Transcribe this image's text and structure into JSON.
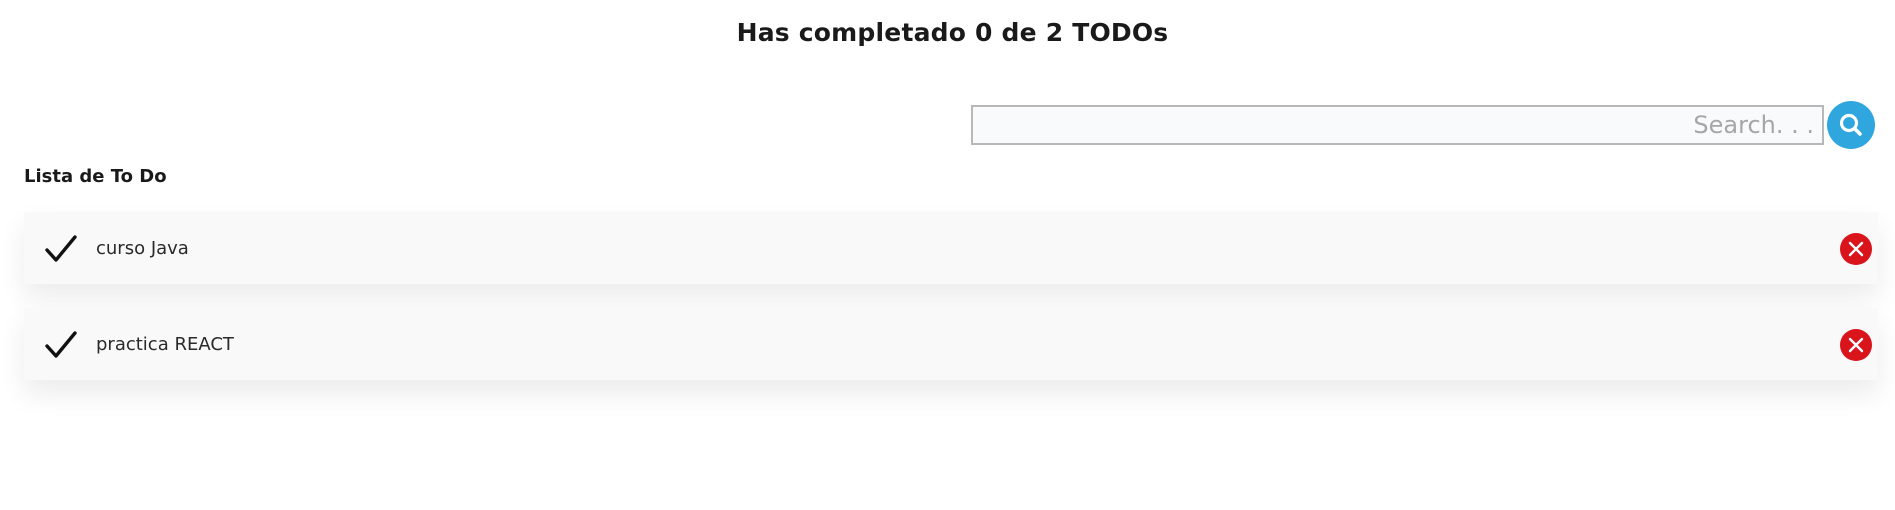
{
  "header": {
    "counter_text": "Has completado 0 de 2 TODOs"
  },
  "search": {
    "placeholder": "Search. . .",
    "value": "",
    "button_icon": "search-icon"
  },
  "list": {
    "title": "Lista de To Do",
    "items": [
      {
        "text": "curso Java",
        "completed": false
      },
      {
        "text": "practica REACT",
        "completed": false
      }
    ]
  },
  "colors": {
    "search_button": "#2fa6dd",
    "delete_button": "#d9141b",
    "item_background": "#f9f9f9"
  }
}
